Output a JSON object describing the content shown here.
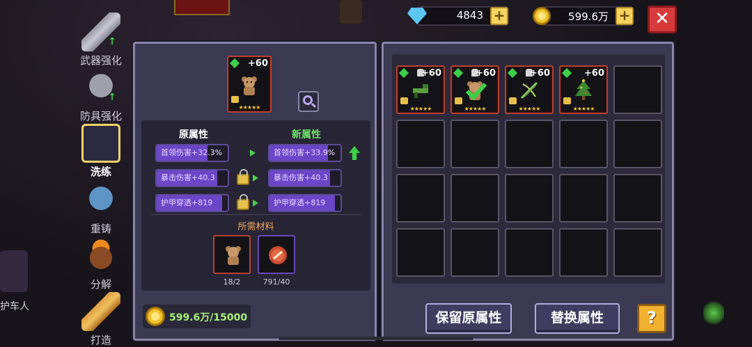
{
  "background": {
    "npc_label": "护车人"
  },
  "nav": {
    "items": [
      {
        "label": "武器强化",
        "icon": "sword-icon",
        "active": false
      },
      {
        "label": "防具强化",
        "icon": "armor-icon",
        "active": false
      },
      {
        "label": "洗练",
        "icon": "crystal-sword-icon",
        "active": true
      },
      {
        "label": "重铸",
        "icon": "blue-armor-icon",
        "active": false
      },
      {
        "label": "分解",
        "icon": "cauldron-icon",
        "active": false
      },
      {
        "label": "打造",
        "icon": "hammer-icon",
        "active": false
      }
    ]
  },
  "currency": {
    "gems": "4843",
    "gold": "599.6万",
    "plus_symbol": "+",
    "close_symbol": "✕"
  },
  "selected_item": {
    "level": "+60",
    "stars": "★★★★★"
  },
  "attributes": {
    "old_header": "原属性",
    "new_header": "新属性",
    "rows": [
      {
        "old": "首领伤害+32.3%",
        "new": "首领伤害+33.9%",
        "locked": false,
        "improved": true,
        "old_fill": 0.72,
        "new_fill": 0.82
      },
      {
        "old": "暴击伤害+40.3",
        "new": "暴击伤害+40.3",
        "locked": true,
        "improved": false,
        "old_fill": 0.85,
        "new_fill": 0.85
      },
      {
        "old": "护甲穿透+819",
        "new": "护甲穿透+819",
        "locked": true,
        "improved": false,
        "old_fill": 0.92,
        "new_fill": 0.92
      }
    ]
  },
  "materials": {
    "title": "所需材料",
    "items": [
      {
        "icon": "teddy-bear-icon",
        "count": "18/2",
        "rarity": "red"
      },
      {
        "icon": "red-stone-icon",
        "count": "791/40",
        "rarity": "purple"
      }
    ]
  },
  "cost": {
    "gold": "599.6万/15000"
  },
  "inventory": {
    "items": [
      {
        "icon": "green-gun-icon",
        "level": "+60",
        "stars": "★★★★★",
        "bell": true,
        "checked": false
      },
      {
        "icon": "teddy-bear-icon",
        "level": "+60",
        "stars": "★★★★★",
        "bell": true,
        "checked": true
      },
      {
        "icon": "green-bow-icon",
        "level": "+60",
        "stars": "★★★★★",
        "bell": true,
        "checked": false
      },
      {
        "icon": "christmas-tree-icon",
        "level": "+60",
        "stars": "★★★★★",
        "bell": false,
        "checked": false
      }
    ],
    "total_slots": 20
  },
  "buttons": {
    "keep": "保留原属性",
    "replace": "替换属性",
    "help": "?"
  }
}
